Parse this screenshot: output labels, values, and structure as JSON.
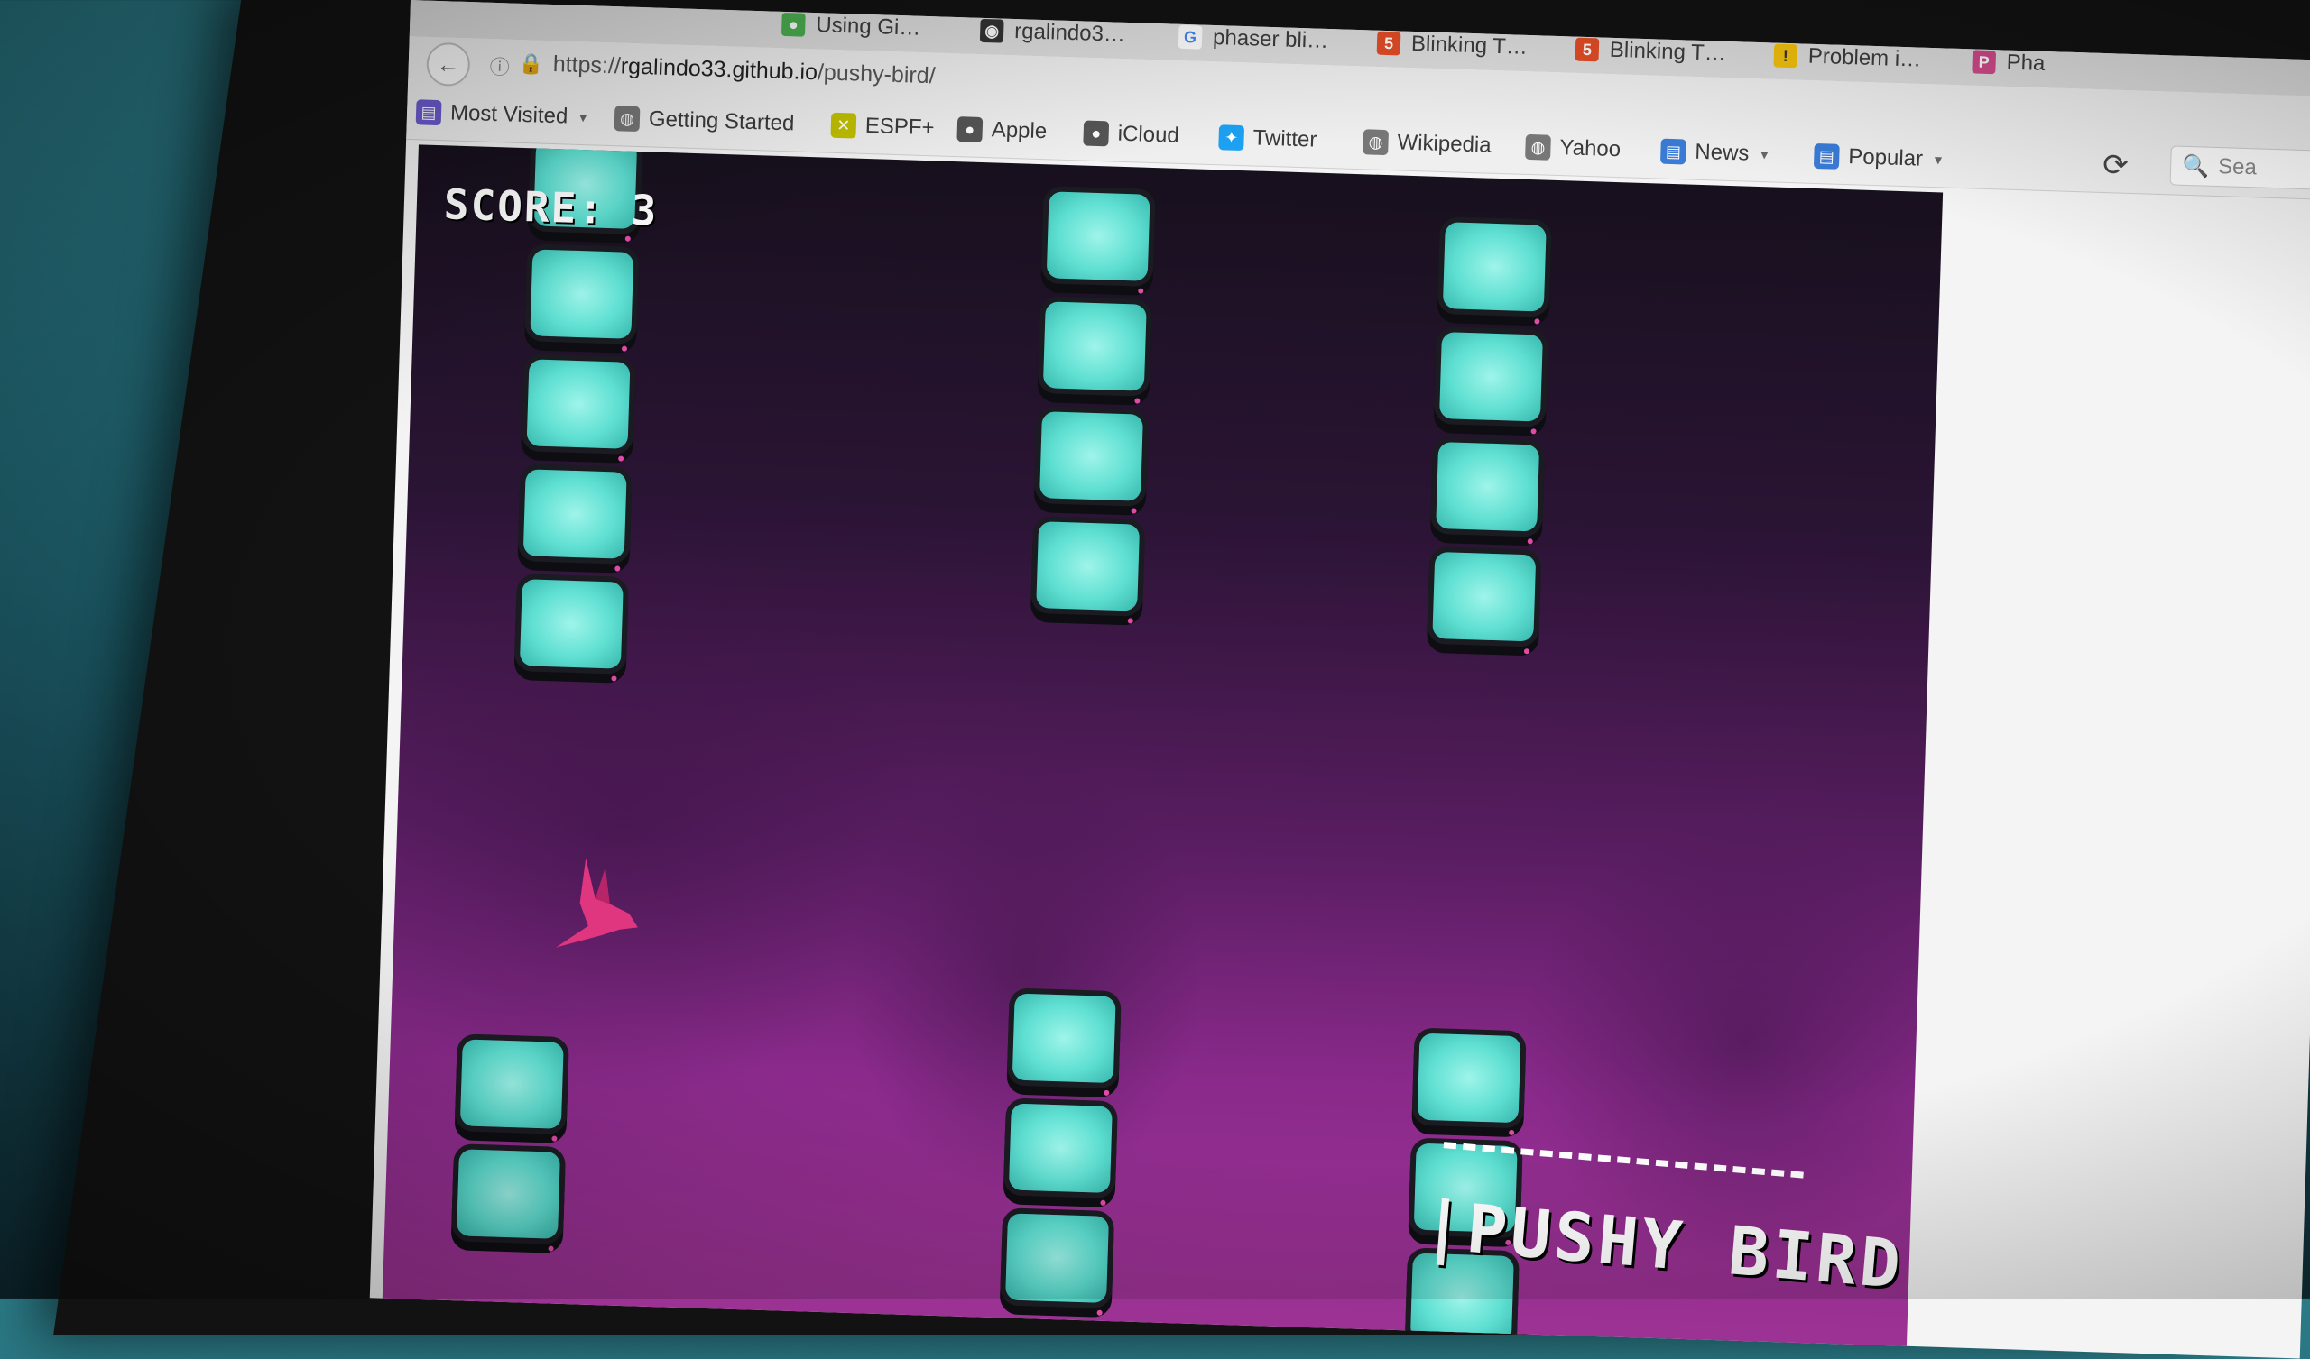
{
  "browser": {
    "tabs": [
      {
        "label": "Using Gi…",
        "icon": "github-icon",
        "color": "#4caf50"
      },
      {
        "label": "rgalindo3…",
        "icon": "github-icon",
        "color": "#333333"
      },
      {
        "label": "phaser bli…",
        "icon": "google-icon",
        "color": "#4285f4"
      },
      {
        "label": "Blinking T…",
        "icon": "html5-icon",
        "color": "#e44d26"
      },
      {
        "label": "Blinking T…",
        "icon": "html5-icon",
        "color": "#e44d26"
      },
      {
        "label": "Problem i…",
        "icon": "warning-icon",
        "color": "#f4c20d"
      },
      {
        "label": "Pha",
        "icon": "phaser-icon",
        "color": "#d04a8a"
      }
    ],
    "url": {
      "scheme": "https://",
      "host": "rgalindo33.github.io",
      "path": "/pushy-bird/"
    },
    "bookmarks": [
      {
        "label": "Most Visited",
        "icon": "folder-icon",
        "dropdown": true,
        "color": "#6a5acd"
      },
      {
        "label": "Getting Started",
        "icon": "globe-icon",
        "dropdown": false,
        "color": "#777777"
      },
      {
        "label": "ESPF+",
        "icon": "espn-icon",
        "dropdown": false,
        "color": "#c0c000"
      },
      {
        "label": "Apple",
        "icon": "apple-icon",
        "dropdown": false,
        "color": "#555555"
      },
      {
        "label": "iCloud",
        "icon": "apple-icon",
        "dropdown": false,
        "color": "#555555"
      },
      {
        "label": "Twitter",
        "icon": "twitter-icon",
        "dropdown": false,
        "color": "#1da1f2"
      },
      {
        "label": "Wikipedia",
        "icon": "globe-icon",
        "dropdown": false,
        "color": "#777777"
      },
      {
        "label": "Yahoo",
        "icon": "globe-icon",
        "dropdown": false,
        "color": "#777777"
      },
      {
        "label": "News",
        "icon": "folder-icon",
        "dropdown": true,
        "color": "#3a7bd5"
      },
      {
        "label": "Popular",
        "icon": "folder-icon",
        "dropdown": true,
        "color": "#3a7bd5"
      }
    ],
    "search_placeholder": "Sea"
  },
  "game": {
    "score_label": "SCORE:",
    "score_value": "3",
    "title": "|PUSHY BIRD|",
    "colors": {
      "tv_screen": "#5fe0d2",
      "bird": "#e0357f",
      "sky_top": "#17101d",
      "sky_bottom": "#9e3394"
    }
  }
}
